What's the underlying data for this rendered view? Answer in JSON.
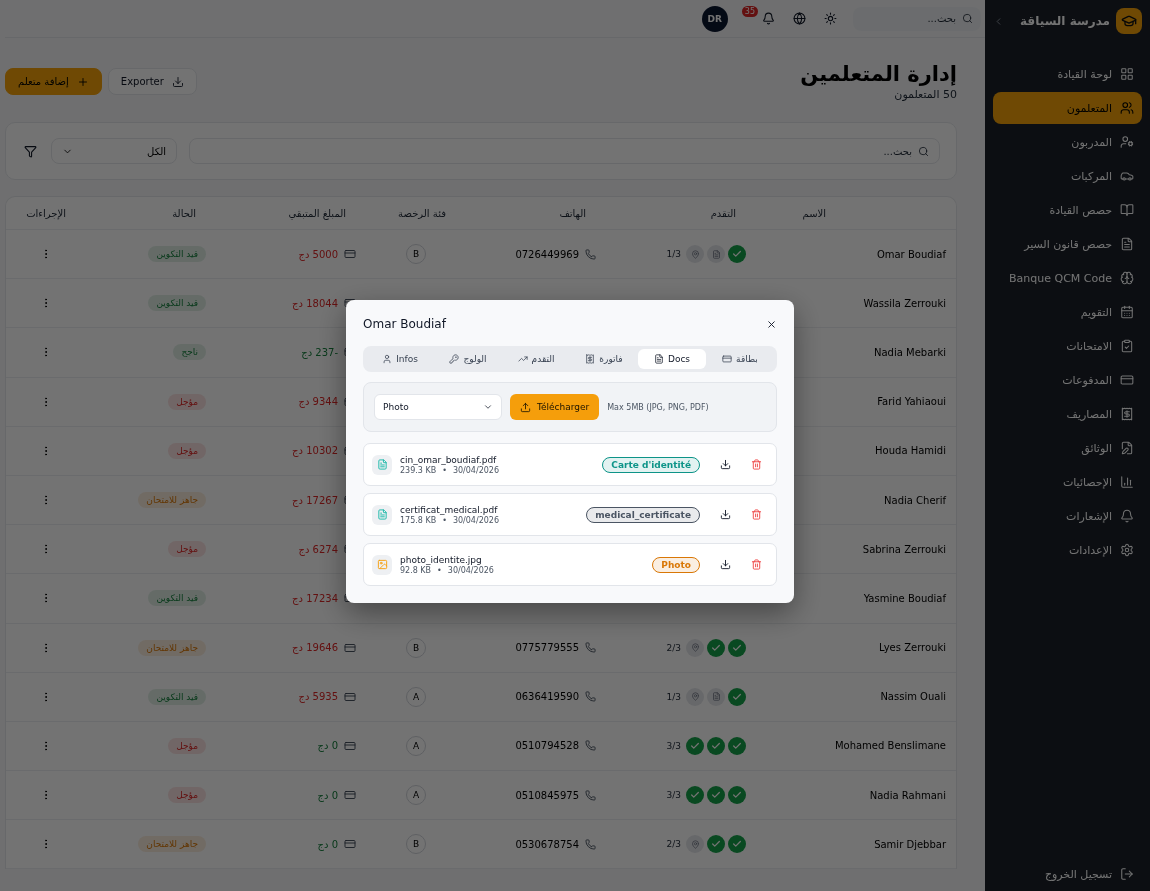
{
  "sidebar": {
    "brand": "مدرسة السياقة",
    "items": [
      {
        "label": "لوحة القيادة",
        "selected": false
      },
      {
        "label": "المتعلمون",
        "selected": true
      },
      {
        "label": "المدربون",
        "selected": false
      },
      {
        "label": "المركبات",
        "selected": false
      },
      {
        "label": "حصص القيادة",
        "selected": false
      },
      {
        "label": "حصص قانون السير",
        "selected": false
      },
      {
        "label": "Banque QCM Code",
        "selected": false
      },
      {
        "label": "التقويم",
        "selected": false
      },
      {
        "label": "الامتحانات",
        "selected": false
      },
      {
        "label": "المدفوعات",
        "selected": false
      },
      {
        "label": "المصاريف",
        "selected": false
      },
      {
        "label": "الوثائق",
        "selected": false
      },
      {
        "label": "الإحصائيات",
        "selected": false
      },
      {
        "label": "الإشعارات",
        "selected": false
      },
      {
        "label": "الإعدادات",
        "selected": false
      }
    ],
    "logout": "تسجيل الخروج"
  },
  "topbar": {
    "search_placeholder": "بحث...",
    "notifications": "35",
    "avatar": "DR"
  },
  "header": {
    "title": "إدارة المتعلمين",
    "subtitle": "50 المتعلمون",
    "add_button": "إضافة متعلم",
    "export_button": "Exporter"
  },
  "filters": {
    "search_placeholder": "بحث...",
    "select_value": "الكل"
  },
  "table": {
    "columns": [
      "الاسم",
      "التقدم",
      "الهاتف",
      "فئة الرخصة",
      "المبلغ المتبقي",
      "الحالة",
      "الإجراءات"
    ],
    "rows": [
      {
        "name": "Omar Boudiaf",
        "progress": {
          "count": "1/3",
          "steps": [
            {
              "done": true
            },
            {
              "done": false
            },
            {
              "done": false
            }
          ]
        },
        "phone": "0726449969",
        "category": "B",
        "amount": "5000 دج",
        "owing": true,
        "status": "قيد التكوين",
        "kind": "training"
      },
      {
        "name": "Wassila Zerrouki",
        "amount": "18044 دج",
        "owing": true,
        "status": "قيد التكوين",
        "kind": "training"
      },
      {
        "name": "Nadia Mebarki",
        "amount": "-237 دج",
        "owing": false,
        "status": "ناجح",
        "kind": "passed"
      },
      {
        "name": "Farid Yahiaoui",
        "amount": "9344 دج",
        "owing": true,
        "status": "مؤجل",
        "kind": "postponed"
      },
      {
        "name": "Houda Hamidi",
        "amount": "10302 دج",
        "owing": true,
        "status": "مؤجل",
        "kind": "postponed"
      },
      {
        "name": "Nadia Cherif",
        "amount": "17267 دج",
        "owing": true,
        "status": "جاهز للامتحان",
        "kind": "ready"
      },
      {
        "name": "Sabrina Zerrouki",
        "amount": "6274 دج",
        "owing": true,
        "status": "مؤجل",
        "kind": "postponed"
      },
      {
        "name": "Yasmine Boudiaf",
        "amount": "17234 دج",
        "owing": true,
        "status": "قيد التكوين",
        "kind": "training"
      },
      {
        "name": "Lyes Zerrouki",
        "progress": {
          "count": "2/3",
          "steps": [
            {
              "done": true
            },
            {
              "done": true
            },
            {
              "done": false
            }
          ]
        },
        "phone": "0775779555",
        "category": "B",
        "amount": "19646 دج",
        "owing": true,
        "status": "جاهز للامتحان",
        "kind": "ready"
      },
      {
        "name": "Nassim Ouali",
        "progress": {
          "count": "1/3",
          "steps": [
            {
              "done": true
            },
            {
              "done": false
            },
            {
              "done": false
            }
          ]
        },
        "phone": "0636419590",
        "category": "A",
        "amount": "5935 دج",
        "owing": true,
        "status": "قيد التكوين",
        "kind": "training"
      },
      {
        "name": "Mohamed Benslimane",
        "progress": {
          "count": "3/3",
          "steps": [
            {
              "done": true
            },
            {
              "done": true
            },
            {
              "done": true
            }
          ]
        },
        "phone": "0510794528",
        "category": "A",
        "amount": "0 دج",
        "owing": false,
        "status": "مؤجل",
        "kind": "postponed"
      },
      {
        "name": "Nadia Rahmani",
        "progress": {
          "count": "3/3",
          "steps": [
            {
              "done": true
            },
            {
              "done": true
            },
            {
              "done": true
            }
          ]
        },
        "phone": "0510845975",
        "category": "A",
        "amount": "0 دج",
        "owing": false,
        "status": "مؤجل",
        "kind": "postponed"
      },
      {
        "name": "Samir Djebbar",
        "progress": {
          "count": "2/3",
          "steps": [
            {
              "done": true
            },
            {
              "done": true
            },
            {
              "done": false
            }
          ]
        },
        "phone": "0530678754",
        "category": "B",
        "amount": "0 دج",
        "owing": false,
        "status": "جاهز للامتحان",
        "kind": "ready"
      }
    ]
  },
  "modal": {
    "title": "Omar Boudiaf",
    "tabs": [
      {
        "label": "بطاقة",
        "selected": false
      },
      {
        "label": "Docs",
        "selected": true
      },
      {
        "label": "فاتورة",
        "selected": false
      },
      {
        "label": "التقدم",
        "selected": false
      },
      {
        "label": "الولوج",
        "selected": false
      },
      {
        "label": "Infos",
        "selected": false
      }
    ],
    "upload": {
      "select_value": "Photo",
      "button": "Télécharger",
      "hint": "Max 5MB (JPG, PNG, PDF)"
    },
    "documents": [
      {
        "name": "cin_omar_boudiaf.pdf",
        "kind": "pdf",
        "size": "239.3 KB",
        "dot": "•",
        "date": "30/04/2026",
        "tag": "Carte d'identité",
        "color": "#0d9488"
      },
      {
        "name": "certificat_medical.pdf",
        "kind": "pdf",
        "size": "175.8 KB",
        "dot": "•",
        "date": "30/04/2026",
        "tag": "medical_certificate",
        "color": "#4b5563"
      },
      {
        "name": "photo_identite.jpg",
        "kind": "image",
        "size": "92.8 KB",
        "dot": "•",
        "date": "30/04/2026",
        "tag": "Photo",
        "color": "#d97706"
      }
    ]
  }
}
